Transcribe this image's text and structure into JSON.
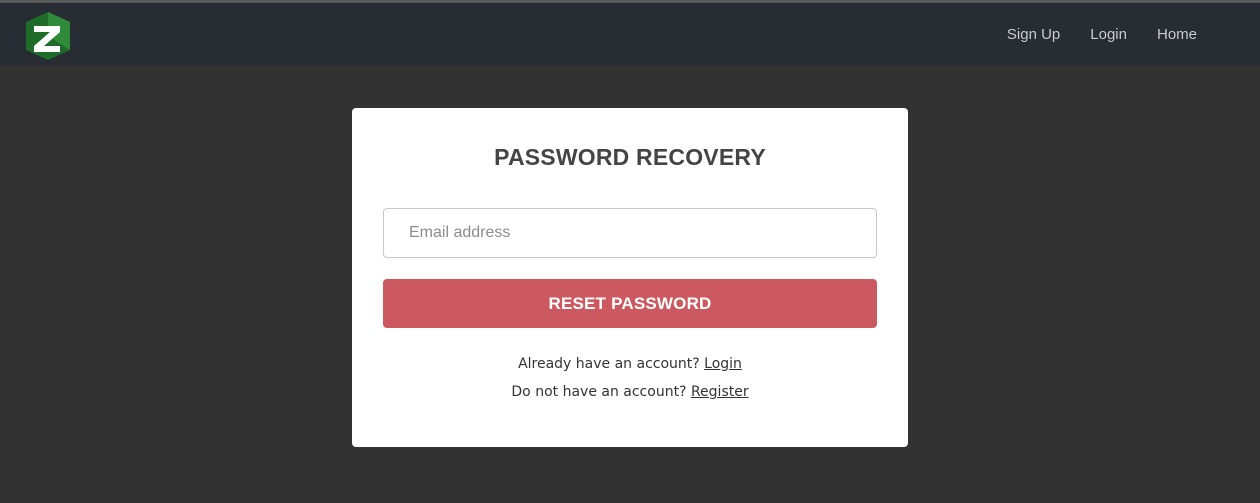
{
  "nav": {
    "logo_letter": "Z",
    "links": [
      {
        "label": "Sign Up"
      },
      {
        "label": "Login"
      },
      {
        "label": "Home"
      }
    ]
  },
  "card": {
    "title": "PASSWORD RECOVERY",
    "email_placeholder": "Email address",
    "email_value": "",
    "reset_button_label": "RESET PASSWORD",
    "login_prompt": "Already have an account?",
    "login_link": "Login",
    "register_prompt": "Do not have an account?",
    "register_link": "Register"
  },
  "colors": {
    "background": "#323232",
    "navbar": "#282c33",
    "logo_green": "#1f6b2a",
    "button": "#cd5960"
  }
}
